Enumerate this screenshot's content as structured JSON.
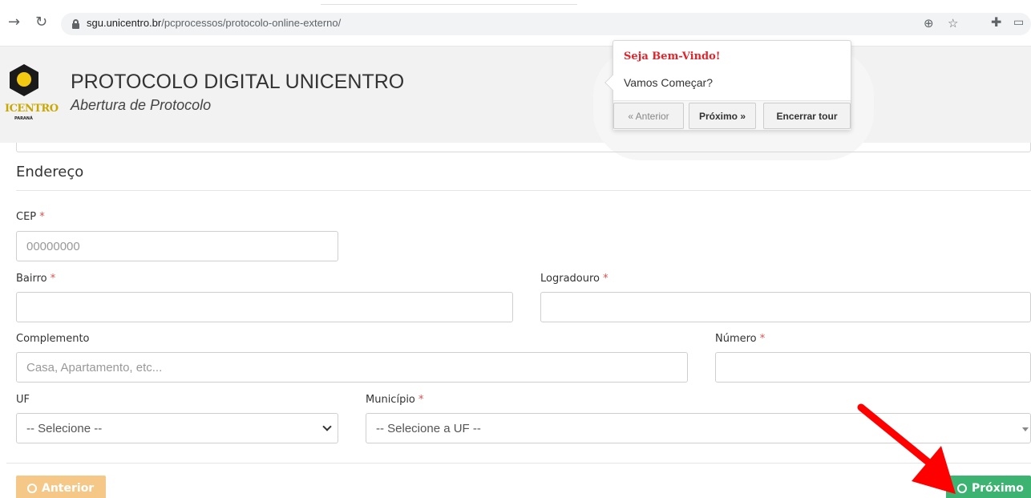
{
  "browser": {
    "url_host": "sgu.unicentro.br",
    "url_path": "/pcprocessos/protocolo-online-externo/",
    "back_icon": "arrow-right-icon",
    "reload_icon": "reload-icon"
  },
  "header": {
    "logo_text": "ICENTRO",
    "logo_subtext": "PARANÁ",
    "title": "PROTOCOLO DIGITAL UNICENTRO",
    "subtitle": "Abertura de Protocolo"
  },
  "tour": {
    "title": "Seja Bem-Vindo!",
    "body": "Vamos Começar?",
    "prev_label": "« Anterior",
    "next_label": "Próximo »",
    "end_label": "Encerrar tour"
  },
  "form": {
    "section_title": "Endereço",
    "required_mark": "*",
    "cep": {
      "label": "CEP",
      "placeholder": "00000000",
      "value": ""
    },
    "bairro": {
      "label": "Bairro",
      "value": ""
    },
    "logradouro": {
      "label": "Logradouro",
      "value": ""
    },
    "complemento": {
      "label": "Complemento",
      "placeholder": "Casa, Apartamento, etc...",
      "value": ""
    },
    "numero": {
      "label": "Número",
      "value": ""
    },
    "uf": {
      "label": "UF",
      "selected": "-- Selecione --"
    },
    "municipio": {
      "label": "Município",
      "selected": "-- Selecione a UF --"
    }
  },
  "footer": {
    "prev_label": "Anterior",
    "next_label": "Próximo"
  },
  "colors": {
    "accent_red": "#e0242b",
    "next_green": "#3cb371",
    "prev_orange": "#f5c888",
    "annotation_arrow": "#ff0000"
  }
}
